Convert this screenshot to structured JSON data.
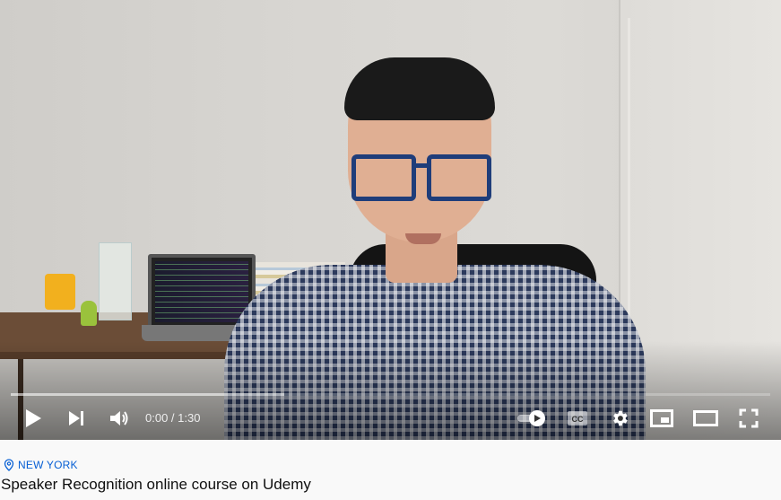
{
  "player": {
    "current_time": "0:00",
    "separator": " / ",
    "duration": "1:30",
    "progress_fraction": 0.0,
    "buffered_fraction": 0.36,
    "autoplay_on": true
  },
  "icons": {
    "play": "play-icon",
    "next": "next-icon",
    "volume": "volume-icon",
    "autoplay": "autoplay-toggle-icon",
    "captions": "cc-icon",
    "settings": "gear-icon",
    "miniplayer": "miniplayer-icon",
    "theater": "theater-mode-icon",
    "fullscreen": "fullscreen-icon",
    "location": "location-pin-icon"
  },
  "video_meta": {
    "location": "NEW YORK",
    "title": "Speaker Recognition online course on Udemy"
  },
  "colors": {
    "location_link": "#065fd4",
    "progress_played": "#ff0000",
    "control_icon": "#ffffff"
  }
}
